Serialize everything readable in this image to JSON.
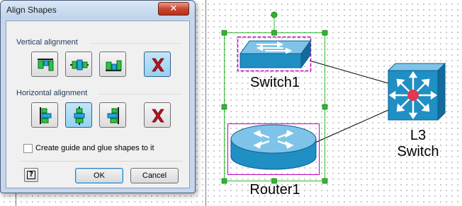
{
  "dialog": {
    "title": "Align Shapes",
    "close_symbol": "✕",
    "vertical_group_label": "Vertical alignment",
    "horizontal_group_label": "Horizontal alignment",
    "vertical_buttons": [
      {
        "name": "align-top",
        "icon": "align-top-icon"
      },
      {
        "name": "align-middle",
        "icon": "align-middle-icon"
      },
      {
        "name": "align-bottom",
        "icon": "align-bottom-icon"
      },
      {
        "name": "no-vertical-alignment",
        "icon": "red-x-icon",
        "pressed": true
      }
    ],
    "horizontal_buttons": [
      {
        "name": "align-left",
        "icon": "align-left-icon"
      },
      {
        "name": "align-center",
        "icon": "align-center-icon",
        "pressed": true
      },
      {
        "name": "align-right",
        "icon": "align-right-icon"
      },
      {
        "name": "no-horizontal-alignment",
        "icon": "red-x-icon"
      }
    ],
    "checkbox_label": "Create guide and glue shapes to it",
    "checkbox_checked": false,
    "help_label": "?",
    "ok_label": "OK",
    "cancel_label": "Cancel"
  },
  "canvas": {
    "shapes": [
      {
        "label": "Switch1",
        "icon": "switch-icon",
        "selected": true
      },
      {
        "label": "Router1",
        "icon": "router-icon",
        "selected": true
      },
      {
        "label_line1": "L3",
        "label_line2": "Switch",
        "icon": "l3-switch-icon",
        "selected": false
      }
    ]
  },
  "colors": {
    "device_blue": "#1f8fc4",
    "selection_green": "#2db82d",
    "selection_magenta": "#c000c0",
    "red_x": "#c0141e",
    "title_close_red": "#c74630"
  }
}
